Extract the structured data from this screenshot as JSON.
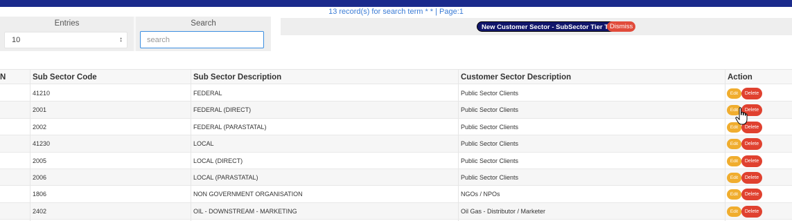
{
  "status_text": "13 record(s) for search term * * | Page:1",
  "entries": {
    "label": "Entries",
    "value": "10"
  },
  "search": {
    "label": "Search",
    "placeholder": "search"
  },
  "tags": {
    "new_label": "New Customer Sector - SubSector Tier Tag",
    "dismiss_label": "Dismiss"
  },
  "table": {
    "headers": [
      "N",
      "Sub Sector Code",
      "Sub Sector Description",
      "Customer Sector Description",
      "Action"
    ],
    "edit_label": "Edit",
    "delete_label": "Delete",
    "rows": [
      {
        "code": "41210",
        "description": "FEDERAL",
        "customer_sector": "Public Sector Clients"
      },
      {
        "code": "2001",
        "description": "FEDERAL (DIRECT)",
        "customer_sector": "Public Sector Clients"
      },
      {
        "code": "2002",
        "description": "FEDERAL (PARASTATAL)",
        "customer_sector": "Public Sector Clients"
      },
      {
        "code": "41230",
        "description": "LOCAL",
        "customer_sector": "Public Sector Clients"
      },
      {
        "code": "2005",
        "description": "LOCAL (DIRECT)",
        "customer_sector": "Public Sector Clients"
      },
      {
        "code": "2006",
        "description": "LOCAL (PARASTATAL)",
        "customer_sector": "Public Sector Clients"
      },
      {
        "code": "1806",
        "description": "NON GOVERNMENT ORGANISATION",
        "customer_sector": "NGOs / NPOs"
      },
      {
        "code": "2402",
        "description": "OIL - DOWNSTREAM - MARKETING",
        "customer_sector": "Oil Gas - Distributor / Marketer"
      }
    ]
  },
  "colors": {
    "topbar": "#1b2a8c",
    "status_text": "#3a7bd5",
    "edit": "#f0ad2e",
    "delete": "#e0412f",
    "tag_new": "#11166b"
  }
}
